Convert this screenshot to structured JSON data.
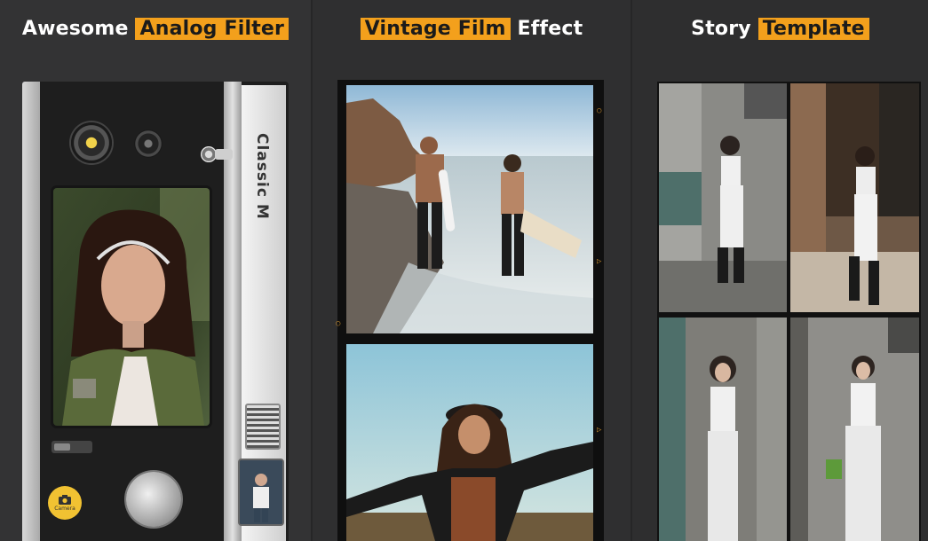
{
  "panels": [
    {
      "title_plain": "Awesome",
      "title_highlight": "Analog Filter"
    },
    {
      "title_highlight": "Vintage Film",
      "title_plain": "Effect"
    },
    {
      "title_plain": "Story",
      "title_highlight": "Template"
    }
  ],
  "camera": {
    "brand_label": "Classic M",
    "camera_button_label": "Camera"
  },
  "colors": {
    "accent": "#f3a01c",
    "background": "#2f2f30"
  }
}
